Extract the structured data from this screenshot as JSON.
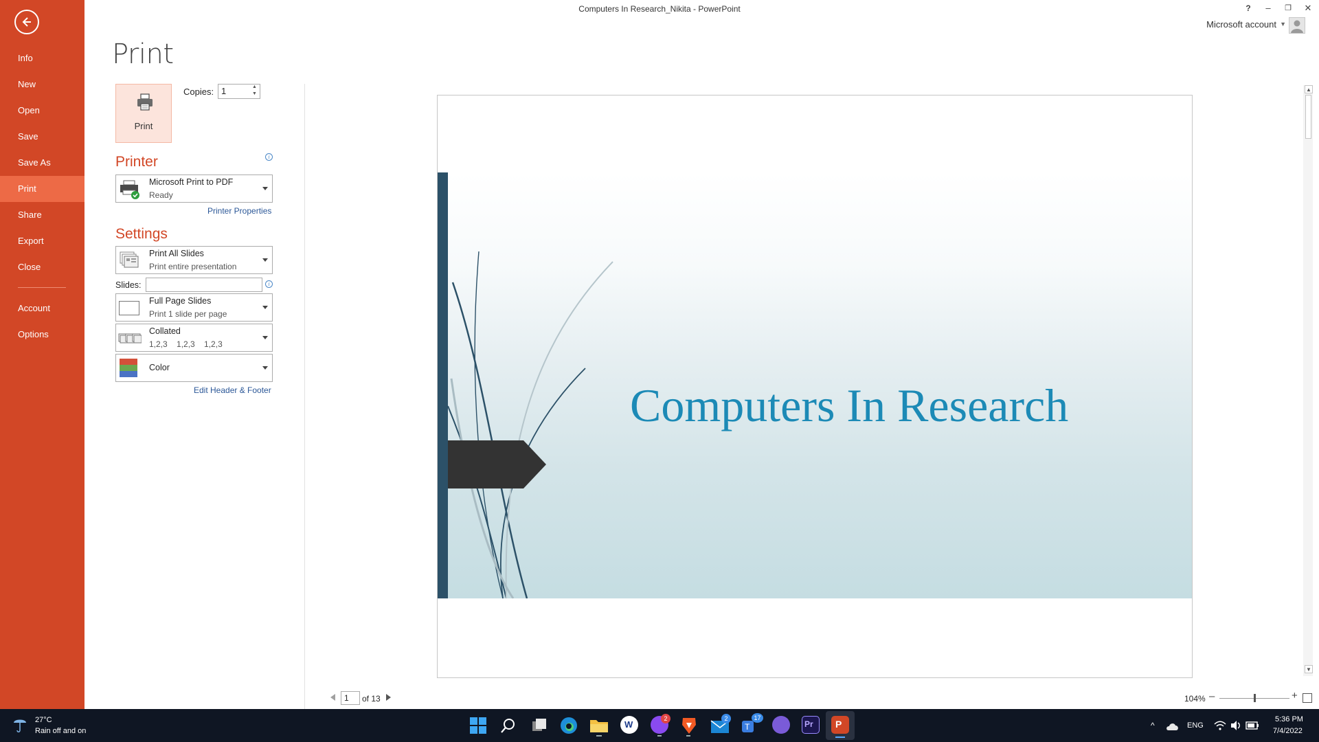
{
  "window": {
    "title": "Computers In Research_Nikita - PowerPoint",
    "help": "?",
    "minimize": "–",
    "restore": "❐",
    "close": "✕",
    "account_label": "Microsoft account"
  },
  "sidebar": {
    "items": [
      {
        "label": "Info"
      },
      {
        "label": "New"
      },
      {
        "label": "Open"
      },
      {
        "label": "Save"
      },
      {
        "label": "Save As"
      },
      {
        "label": "Print"
      },
      {
        "label": "Share"
      },
      {
        "label": "Export"
      },
      {
        "label": "Close"
      },
      {
        "label": "Account"
      },
      {
        "label": "Options"
      }
    ],
    "active": "Print"
  },
  "print": {
    "title": "Print",
    "button_label": "Print",
    "copies_label": "Copies:",
    "copies_value": "1",
    "printer_heading": "Printer",
    "printer_name": "Microsoft Print to PDF",
    "printer_status": "Ready",
    "printer_properties": "Printer Properties",
    "settings_heading": "Settings",
    "range_main": "Print All Slides",
    "range_sub": "Print entire presentation",
    "slides_label": "Slides:",
    "slides_value": "",
    "layout_main": "Full Page Slides",
    "layout_sub": "Print 1 slide per page",
    "collate_main": "Collated",
    "collate_sub": "1,2,3    1,2,3    1,2,3",
    "color_main": "Color",
    "edit_header_footer": "Edit Header & Footer"
  },
  "preview": {
    "slide_title": "Computers In Research",
    "current_page": "1",
    "page_total": "of 13",
    "zoom": "104%",
    "zoom_level_fraction": 0.5
  },
  "taskbar": {
    "temperature": "27°C",
    "weather": "Rain off and on",
    "language": "ENG",
    "time": "5:36 PM",
    "date": "7/4/2022",
    "badges": {
      "messenger": "2",
      "mail": "2",
      "teams": "17"
    }
  },
  "colors": {
    "sidebar": "#D24726",
    "sidebar_active": "#ED6A46",
    "accent_heading": "#D24726",
    "slide_title": "#1C8AB6",
    "slide_bar": "#2C5168",
    "taskbar": "#0f1623"
  }
}
